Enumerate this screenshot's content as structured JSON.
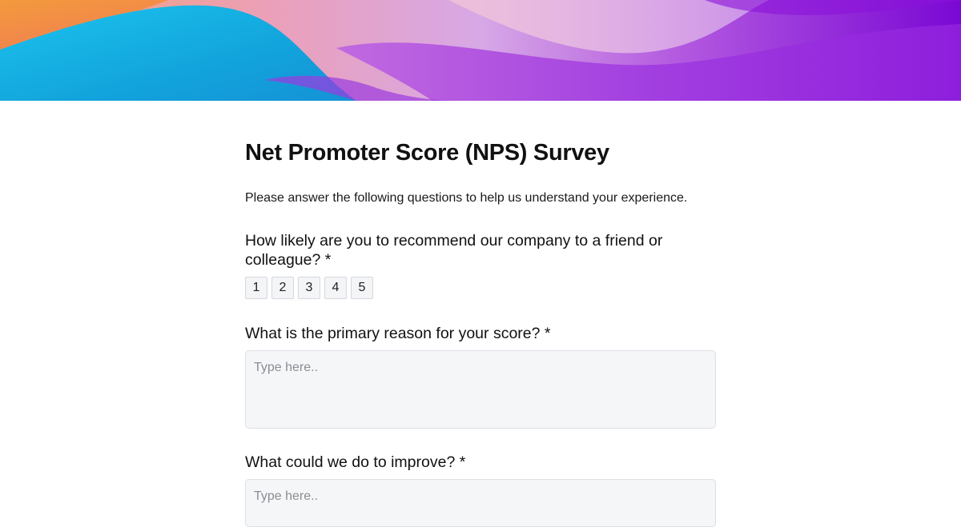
{
  "form": {
    "title": "Net Promoter Score (NPS) Survey",
    "intro": "Please answer the following questions to help us understand your experience.",
    "questions": [
      {
        "label": "How likely are you to recommend our company to a friend or colleague? *",
        "type": "rating",
        "options": [
          "1",
          "2",
          "3",
          "4",
          "5"
        ]
      },
      {
        "label": "What is the primary reason for your score? *",
        "type": "text",
        "placeholder": "Type here.."
      },
      {
        "label": "What could we do to improve? *",
        "type": "text",
        "placeholder": "Type here.."
      }
    ]
  },
  "colors": {
    "banner_orange": "#f2894a",
    "banner_blue": "#14a9e0",
    "banner_pink": "#e08fc8",
    "banner_purple": "#8a10d8",
    "input_background": "#f5f6f8"
  }
}
